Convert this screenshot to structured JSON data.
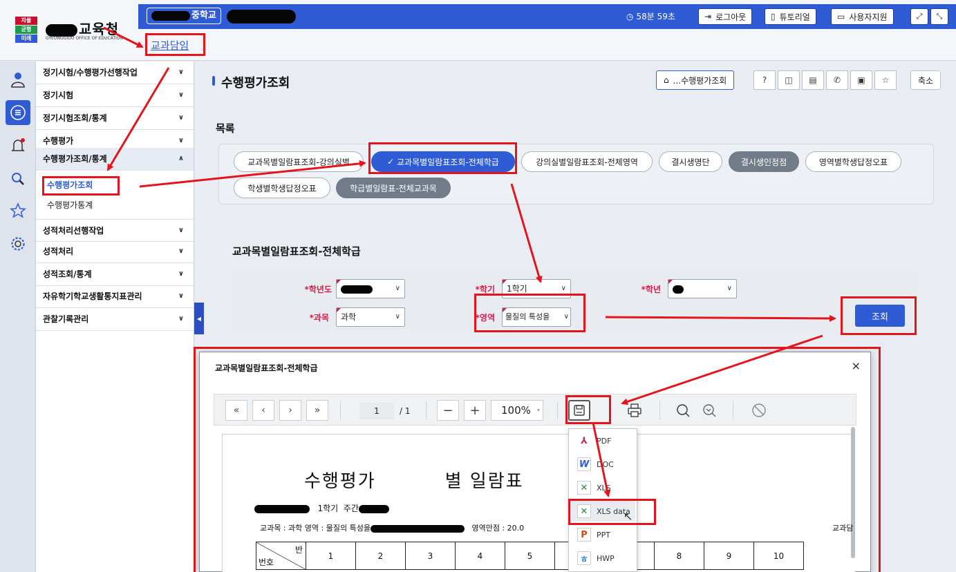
{
  "header": {
    "school_suffix": "중학교",
    "timer": "58분 59초",
    "logout": "로그아웃",
    "tutorial": "튜토리얼",
    "support": "사용자지원"
  },
  "logo": {
    "badge": [
      "자율",
      "균형",
      "미래"
    ],
    "title": "교육청",
    "subtitle": "GYEONGGIDO OFFICE OF EDUCATION",
    "role": "교과담임"
  },
  "sidebar": {
    "items": [
      {
        "label": "정기시험/수행평가선행작업",
        "chev": "∨"
      },
      {
        "label": "정기시험",
        "chev": "∨"
      },
      {
        "label": "정기시험조회/통계",
        "chev": "∨"
      },
      {
        "label": "수행평가",
        "chev": "∨"
      },
      {
        "label": "수행평가조회/통계",
        "chev": "∧"
      },
      {
        "label": "성적처리선행작업",
        "chev": "∨"
      },
      {
        "label": "성적처리",
        "chev": "∨"
      },
      {
        "label": "성적조회/통계",
        "chev": "∨"
      },
      {
        "label": "자유학기학교생활통지표관리",
        "chev": "∨"
      },
      {
        "label": "관찰기록관리",
        "chev": "∨"
      }
    ],
    "sub_items": [
      "수행평가조회",
      "수행평가통계"
    ]
  },
  "main": {
    "page_title": "수행평가조회",
    "fav_label": "...수행평가조회",
    "shrink": "축소",
    "list_label": "목록",
    "tabs": [
      "교과목별일람표조회-강의실별",
      "교과목별일람표조회-전체학급",
      "강의실별일람표조회-전체영역",
      "결시생명단",
      "결시생인정점",
      "영역별학생답정오표",
      "학생별학생답정오표",
      "학급별일람표-전체교과목"
    ],
    "section_title": "교과목별일람표조회-전체학급",
    "form": {
      "year_label": "*학년도",
      "semester_label": "*학기",
      "semester_value": "1학기",
      "grade_label": "*학년",
      "subject_label": "*과목",
      "subject_value": "과학",
      "area_label": "*영역",
      "area_value": "물질의 특성을"
    },
    "search_button": "조회"
  },
  "modal": {
    "title": "교과목별일람표조회-전체학급",
    "close": "×",
    "page_current": "1",
    "page_total": "/ 1",
    "zoom": "100%",
    "save_menu": [
      "PDF",
      "DOC",
      "XLS",
      "XLS data",
      "PPT",
      "HWP"
    ],
    "report": {
      "title": "수행평가",
      "title_tail": "별 일람표",
      "line1_semester": "1학기",
      "line1_label": "주간",
      "line2": "교과목 : 과학   영역 : 물질의 특성을",
      "line2_tail": "영역만점 : 20.0",
      "right_label": "교과담",
      "header_ban": "반",
      "header_num": "번호",
      "columns": [
        "1",
        "2",
        "3",
        "4",
        "5",
        "",
        "",
        "8",
        "9",
        "10"
      ]
    }
  },
  "colors": {
    "primary": "#2f5bd4",
    "required": "#d0204a",
    "annotation": "#e3141b"
  }
}
